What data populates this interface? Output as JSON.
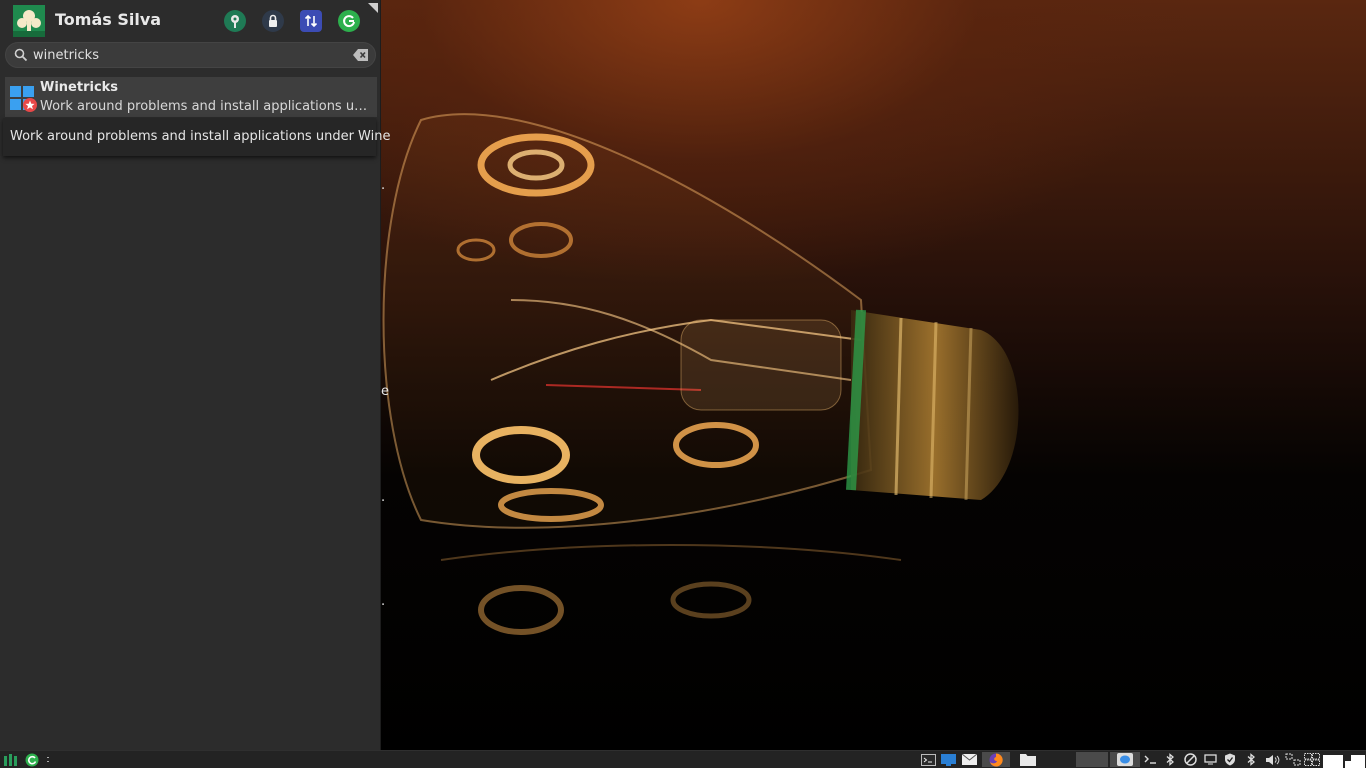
{
  "user": {
    "name": "Tomás Silva"
  },
  "header_buttons": [
    {
      "icon": "settings-manager-icon"
    },
    {
      "icon": "lock-screen-icon"
    },
    {
      "icon": "switch-user-icon"
    },
    {
      "icon": "log-out-icon"
    }
  ],
  "search": {
    "value": "winetricks",
    "placeholder": ""
  },
  "results": [
    {
      "title": "Winetricks",
      "description": "Work around problems and install applications under Wine",
      "icon": "winetricks-icon"
    }
  ],
  "tooltip": {
    "text": "Work around problems and install applications under Wine"
  },
  "taskbar": {
    "left_icons": [
      "whisker-menu-icon",
      "update-notifier-icon"
    ],
    "launchers": [
      "terminal-icon",
      "show-desktop-icon",
      "mail-icon",
      "firefox-icon",
      "file-manager-icon"
    ],
    "tray_icons": [
      "messenger-icon",
      "terminal-small-icon",
      "bluetooth-icon",
      "no-entry-icon",
      "display-icon",
      "shield-icon",
      "bluetooth-2-icon",
      "volume-icon",
      "network-icon",
      "workspace-icon"
    ]
  },
  "colors": {
    "panel_bg": "#2c2c2c",
    "accent": "#1f8a4e",
    "taskbar_bg": "#232323"
  }
}
